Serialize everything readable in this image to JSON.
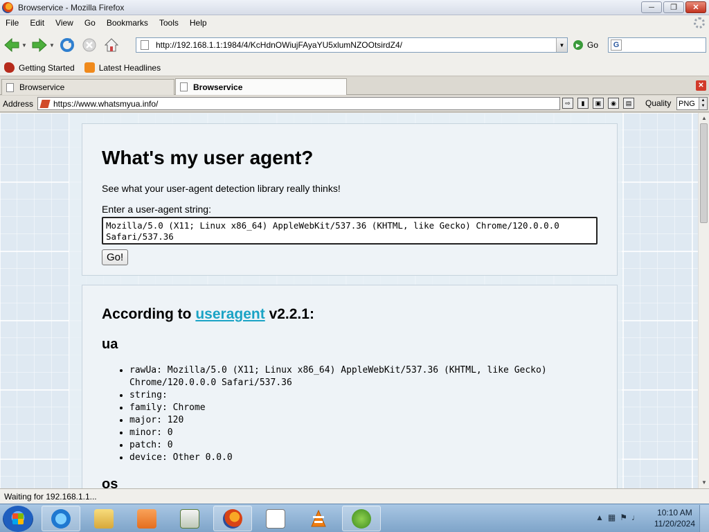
{
  "window": {
    "title": "Browservice - Mozilla Firefox",
    "controls": [
      "minimize",
      "maximize",
      "close"
    ]
  },
  "menu": [
    "File",
    "Edit",
    "View",
    "Go",
    "Bookmarks",
    "Tools",
    "Help"
  ],
  "nav": {
    "url": "http://192.168.1.1:1984/4/KcHdnOWiujFAyaYU5xlumNZOOtsirdZ4/",
    "go_label": "Go",
    "search_engine": "G"
  },
  "bookmarks": [
    "Getting Started",
    "Latest Headlines"
  ],
  "tabs": [
    {
      "label": "Browservice",
      "active": false
    },
    {
      "label": "Browservice",
      "active": true
    }
  ],
  "browservice": {
    "address_label": "Address",
    "address_value": "https://www.whatsmyua.info/",
    "quality_label": "Quality",
    "quality_value": "PNG"
  },
  "page": {
    "heading": "What's my user agent?",
    "description": "See what your user-agent detection library really thinks!",
    "input_label": "Enter a user-agent string:",
    "input_value": "Mozilla/5.0 (X11; Linux x86_64) AppleWebKit/537.36 (KHTML, like Gecko) Chrome/120.0.0.0\nSafari/537.36",
    "go_button": "Go!",
    "according_prefix": "According to",
    "according_link": "useragent",
    "according_suffix": "v2.2.1:",
    "section_ua": "ua",
    "ua_items": [
      "rawUa: Mozilla/5.0 (X11; Linux x86_64) AppleWebKit/537.36 (KHTML, like Gecko)\nChrome/120.0.0.0 Safari/537.36",
      "string:",
      "family: Chrome",
      "major: 120",
      "minor: 0",
      "patch: 0",
      "device: Other 0.0.0"
    ],
    "section_os": "os"
  },
  "status": "Waiting for 192.168.1.1...",
  "taskbar": {
    "apps": [
      "internet-explorer",
      "file-explorer",
      "media-player",
      "windows-explorer",
      "firefox",
      "notepad",
      "vlc",
      "utorrent"
    ],
    "time": "10:10 AM",
    "date": "11/20/2024"
  },
  "colors": {
    "link": "#1aa3c5",
    "page_background": "#dfe9f2"
  }
}
